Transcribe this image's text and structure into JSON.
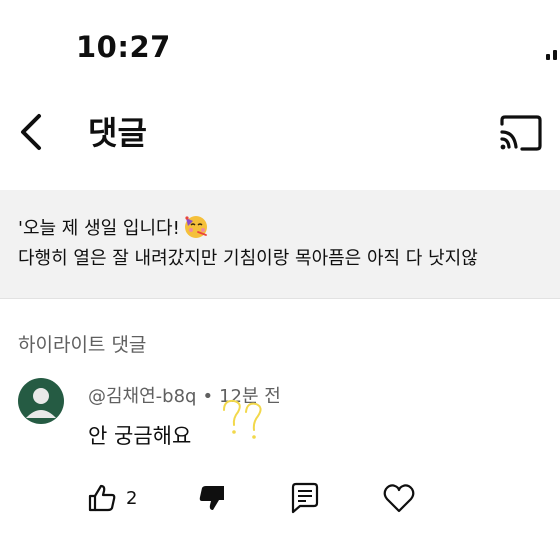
{
  "status_bar": {
    "time": "10:27"
  },
  "header": {
    "title": "댓글"
  },
  "pinned_comment": {
    "line1": "'오늘 제 생일 입니다!",
    "line2": "다행히 열은 잘 내려갔지만 기침이랑 목아픔은 아직 다 낫지않"
  },
  "section": {
    "title": "하이라이트 댓글"
  },
  "comment": {
    "author": "@김채연-b8q",
    "separator": "•",
    "time_ago": "12분 전",
    "text": "안 궁금해요",
    "like_count": "2"
  },
  "icons": {
    "back": "chevron-left-icon",
    "cast": "cast-icon",
    "like": "thumbs-up-icon",
    "dislike": "thumbs-down-icon",
    "reply": "comment-icon",
    "heart": "heart-icon"
  },
  "colors": {
    "avatar_bg": "#255b43",
    "doodle": "#f2d84b",
    "pinned_bg": "#f2f2f2"
  }
}
